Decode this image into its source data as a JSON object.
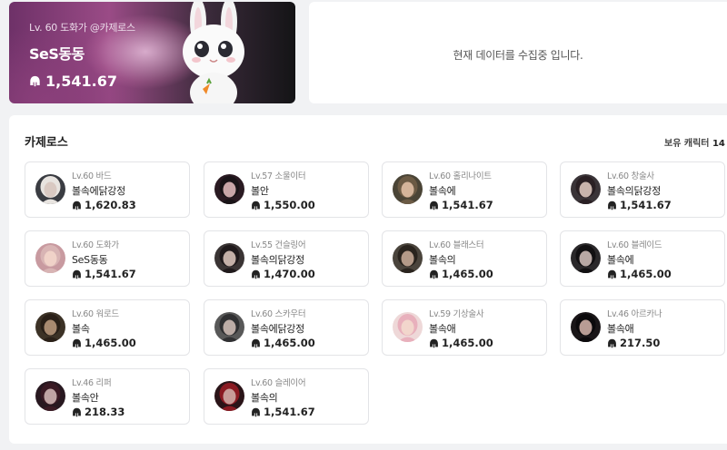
{
  "profile": {
    "level_line": "Lv. 60 도화가 @카제로스",
    "name": "SeS동동",
    "item_level": "1,541.67"
  },
  "status_message": "현재 데이터를 수집중 입니다.",
  "roster": {
    "server": "카제로스",
    "count_label": "보유 캐릭터",
    "count": "14",
    "characters": [
      {
        "cls": "Lv.60 바드",
        "name": "볼속에닭강정",
        "lvl": "1,620.83",
        "skin": "#d9c9c2",
        "hair": "#e8e4e0",
        "bg": "#3a3c42"
      },
      {
        "cls": "Lv.57 소울이터",
        "name": "볼안",
        "lvl": "1,550.00",
        "skin": "#c9a6a8",
        "hair": "#1a1418",
        "bg": "#2a1a22"
      },
      {
        "cls": "Lv.60 홀리나이트",
        "name": "볼속에",
        "lvl": "1,541.67",
        "skin": "#d4b49a",
        "hair": "#6b5a44",
        "bg": "#4a4436"
      },
      {
        "cls": "Lv.60 창술사",
        "name": "볼속의닭강정",
        "lvl": "1,541.67",
        "skin": "#c8b4ac",
        "hair": "#2a2024",
        "bg": "#3a3438"
      },
      {
        "cls": "Lv.60 도화가",
        "name": "SeS동동",
        "lvl": "1,541.67",
        "skin": "#f0d2c8",
        "hair": "#d8b4b4",
        "bg": "#c89aa0"
      },
      {
        "cls": "Lv.55 건슬링어",
        "name": "볼속의닭강정",
        "lvl": "1,470.00",
        "skin": "#c4b0a8",
        "hair": "#201a1c",
        "bg": "#3a3434"
      },
      {
        "cls": "Lv.60 블래스터",
        "name": "볼속의",
        "lvl": "1,465.00",
        "skin": "#b49a88",
        "hair": "#2a241e",
        "bg": "#4a443c"
      },
      {
        "cls": "Lv.60 블레이드",
        "name": "볼속에",
        "lvl": "1,465.00",
        "skin": "#b8a8a4",
        "hair": "#121012",
        "bg": "#2a282a"
      },
      {
        "cls": "Lv.60 워로드",
        "name": "볼속",
        "lvl": "1,465.00",
        "skin": "#a88a70",
        "hair": "#2a2018",
        "bg": "#3c3226"
      },
      {
        "cls": "Lv.60 스카우터",
        "name": "볼속에닭강정",
        "lvl": "1,465.00",
        "skin": "#bcaca6",
        "hair": "#303032",
        "bg": "#585858"
      },
      {
        "cls": "Lv.59 기상술사",
        "name": "볼속애",
        "lvl": "1,465.00",
        "skin": "#f2d6cc",
        "hair": "#e8b0bc",
        "bg": "#eed8d8"
      },
      {
        "cls": "Lv.46 아르카나",
        "name": "볼속애",
        "lvl": "217.50",
        "skin": "#b89c94",
        "hair": "#0c0a0c",
        "bg": "#1a1618"
      },
      {
        "cls": "Lv.46 리퍼",
        "name": "볼속안",
        "lvl": "218.33",
        "skin": "#c0a4a4",
        "hair": "#3a1a24",
        "bg": "#281820"
      },
      {
        "cls": "Lv.60 슬레이어",
        "name": "볼속의",
        "lvl": "1,541.67",
        "skin": "#c89c98",
        "hair": "#8a1a22",
        "bg": "#2a1418"
      }
    ]
  },
  "icons": {
    "helmet": "helmet-icon",
    "bunny": "bunny-character-image"
  },
  "colors": {
    "banner_accent": "#8a3f7a",
    "page_bg": "#f1f2f4"
  }
}
